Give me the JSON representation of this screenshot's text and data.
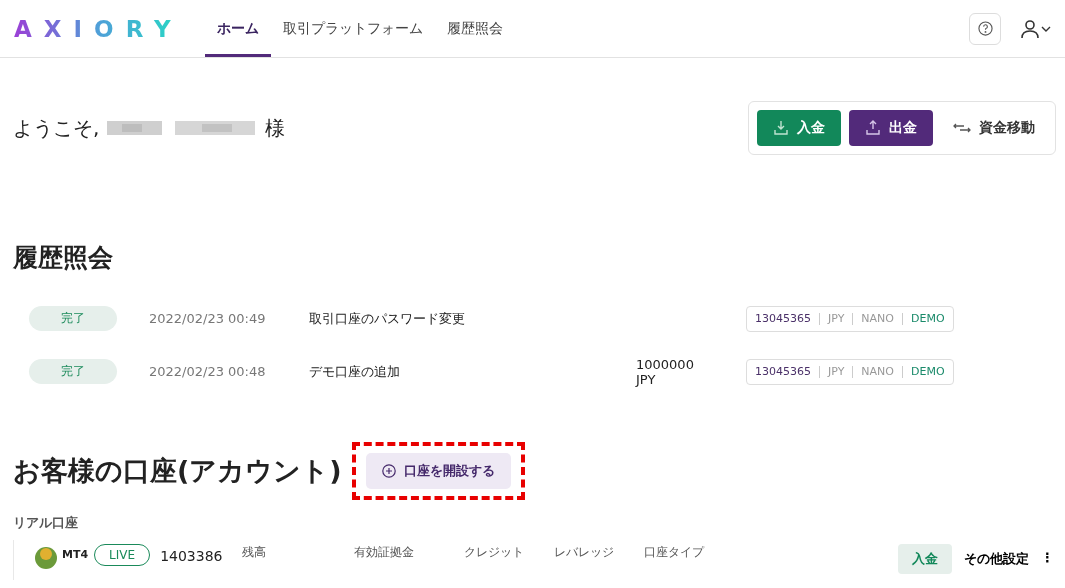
{
  "header": {
    "logo": "AXIORY",
    "nav": [
      {
        "label": "ホーム",
        "selected": true
      },
      {
        "label": "取引プラットフォーム",
        "selected": false
      },
      {
        "label": "履歴照会",
        "selected": false
      }
    ]
  },
  "welcome": {
    "prefix": "ようこそ,",
    "suffix": "様"
  },
  "actions": [
    {
      "kind": "deposit",
      "label": "入金"
    },
    {
      "kind": "withdraw",
      "label": "出金"
    },
    {
      "kind": "transfer",
      "label": "資金移動"
    }
  ],
  "history": {
    "title": "履歴照会",
    "rows": [
      {
        "status": "完了",
        "datetime": "2022/02/23 00:49",
        "description": "取引口座のパスワード変更",
        "amount": [],
        "account": "13045365",
        "currency": "JPY",
        "type": "NANO",
        "mode": "DEMO"
      },
      {
        "status": "完了",
        "datetime": "2022/02/23 00:48",
        "description": "デモ口座の追加",
        "amount": [
          "1000000",
          "JPY"
        ],
        "account": "13045365",
        "currency": "JPY",
        "type": "NANO",
        "mode": "DEMO"
      }
    ]
  },
  "accounts": {
    "title": "お客様の口座(アカウント)",
    "open_button": "口座を開設する",
    "highlighted": true,
    "section": "リアル口座",
    "row": {
      "platform": "MT4",
      "badge": "LIVE",
      "number": "1403386",
      "columns": [
        "残高",
        "有効証拠金",
        "クレジット",
        "レバレッジ",
        "口座タイプ"
      ],
      "deposit": "入金",
      "settings": "その他設定",
      "more": "⋮"
    }
  }
}
